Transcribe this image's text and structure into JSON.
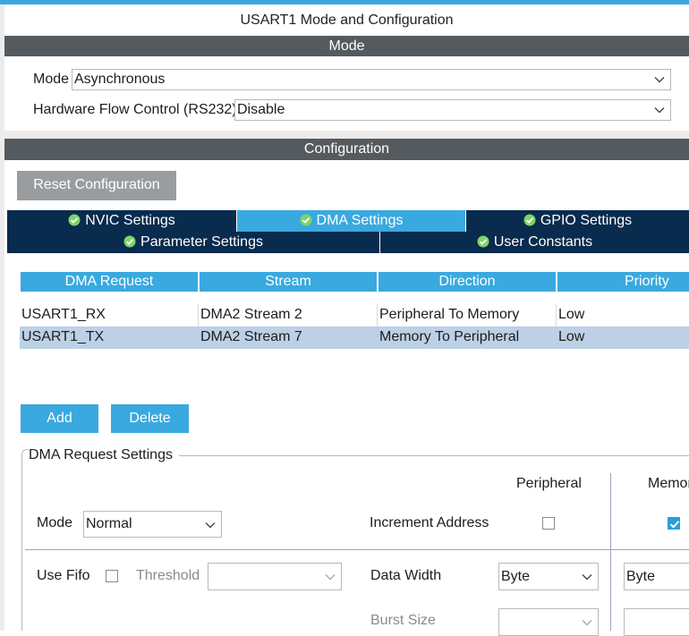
{
  "window": {
    "title": "USART1 Mode and Configuration"
  },
  "mode_section": {
    "header": "Mode",
    "mode_label": "Mode",
    "mode_value": "Asynchronous",
    "flow_label": "Hardware Flow Control (RS232)",
    "flow_value": "Disable"
  },
  "config_section": {
    "header": "Configuration",
    "reset_label": "Reset Configuration",
    "tabs": [
      {
        "label": "NVIC Settings"
      },
      {
        "label": "DMA Settings"
      },
      {
        "label": "GPIO Settings"
      },
      {
        "label": "Parameter Settings"
      },
      {
        "label": "User Constants"
      }
    ],
    "active_tab": "DMA Settings"
  },
  "dma_table": {
    "columns": [
      "DMA Request",
      "Stream",
      "Direction",
      "Priority"
    ],
    "rows": [
      [
        "USART1_RX",
        "DMA2 Stream 2",
        "Peripheral To Memory",
        "Low"
      ],
      [
        "USART1_TX",
        "DMA2 Stream 7",
        "Memory To Peripheral",
        "Low"
      ]
    ],
    "selected_row": 1
  },
  "actions": {
    "add_label": "Add",
    "delete_label": "Delete"
  },
  "request_settings": {
    "group_title": "DMA Request Settings",
    "mode_label": "Mode",
    "mode_value": "Normal",
    "use_fifo_label": "Use Fifo",
    "use_fifo_checked": false,
    "threshold_label": "Threshold",
    "threshold_value": "",
    "peripheral_header": "Peripheral",
    "memory_header": "Memor",
    "increment_label": "Increment Address",
    "peripheral_increment": false,
    "memory_increment": true,
    "data_width_label": "Data Width",
    "peripheral_width": "Byte",
    "memory_width": "Byte",
    "burst_label": "Burst Size",
    "peripheral_burst": "",
    "memory_burst": ""
  },
  "colors": {
    "accent": "#3aa9df",
    "tab_dark": "#082b4e",
    "section_bar": "#555a5e",
    "selection": "#bcd0e6"
  }
}
